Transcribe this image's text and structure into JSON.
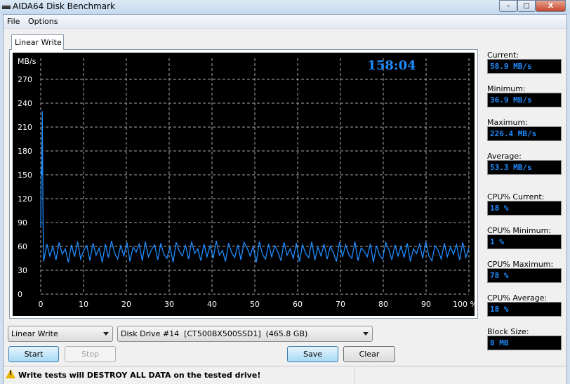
{
  "window": {
    "title": "AIDA64 Disk Benchmark",
    "minimize": "–",
    "maximize": "□",
    "close": "X"
  },
  "menu": [
    "File",
    "Options"
  ],
  "tab": "Linear Write",
  "stats": [
    {
      "label": "Current:",
      "value": "58.9 MB/s"
    },
    {
      "label": "Minimum:",
      "value": "36.9 MB/s"
    },
    {
      "label": "Maximum:",
      "value": "226.4 MB/s"
    },
    {
      "label": "Average:",
      "value": "53.3 MB/s"
    },
    {
      "label": "CPU% Current:",
      "value": "18 %"
    },
    {
      "label": "CPU% Minimum:",
      "value": "1 %"
    },
    {
      "label": "CPU% Maximum:",
      "value": "78 %"
    },
    {
      "label": "CPU% Average:",
      "value": "18 %"
    },
    {
      "label": "Block Size:",
      "value": "8 MB"
    }
  ],
  "controls": {
    "test_select": "Linear Write",
    "drive_select": "Disk Drive #14  [CT500BX500SSD1]  (465.8 GB)",
    "start": "Start",
    "stop": "Stop",
    "save": "Save",
    "clear": "Clear"
  },
  "status": {
    "message": "Write tests will DESTROY ALL DATA on the tested drive!"
  },
  "colors": {
    "series": "#1e8cff",
    "background": "#000000",
    "accent_text": "#1e8cff"
  },
  "chart_data": {
    "type": "line",
    "ylabel": "MB/s",
    "timer": "158:04",
    "ylim": [
      0,
      270
    ],
    "xlim": [
      0,
      100
    ],
    "yticks": [
      "0",
      "30",
      "60",
      "90",
      "120",
      "150",
      "180",
      "210",
      "240",
      "270"
    ],
    "xticks": [
      "0",
      "10",
      "20",
      "30",
      "40",
      "50",
      "60",
      "70",
      "80",
      "90",
      "100 %"
    ],
    "grid": true,
    "series": [
      {
        "x_range": [
          0,
          100
        ],
        "values": [
          85,
          157,
          150,
          230,
          145,
          62,
          41,
          63,
          48,
          60,
          43,
          65,
          50,
          57,
          40,
          62,
          47,
          66,
          44,
          55,
          61,
          42,
          64,
          49,
          58,
          40,
          63,
          46,
          67,
          52,
          44,
          61,
          48,
          65,
          41,
          59,
          53,
          63,
          42,
          66,
          47,
          56,
          62,
          43,
          64,
          50,
          45,
          60,
          40,
          65,
          54,
          48,
          62,
          44,
          66,
          51,
          57,
          42,
          63,
          47,
          61,
          45,
          67,
          49,
          55,
          41,
          64,
          52,
          46,
          62,
          43,
          65,
          58,
          48,
          60,
          40,
          66,
          50,
          44,
          63,
          47,
          61,
          53,
          42,
          65,
          49,
          57,
          45,
          64,
          41,
          62,
          51,
          46,
          66,
          43,
          59,
          48,
          63,
          44,
          60,
          52,
          41,
          65,
          47,
          62,
          50,
          45,
          66,
          42,
          58,
          54,
          47,
          63,
          40,
          61,
          49,
          44,
          65,
          56,
          43,
          62,
          48,
          60,
          46,
          64,
          41,
          57,
          51,
          63,
          45,
          66,
          48,
          42,
          61,
          55,
          44,
          64,
          47,
          59,
          50,
          62,
          43,
          65,
          46,
          58
        ]
      }
    ]
  }
}
